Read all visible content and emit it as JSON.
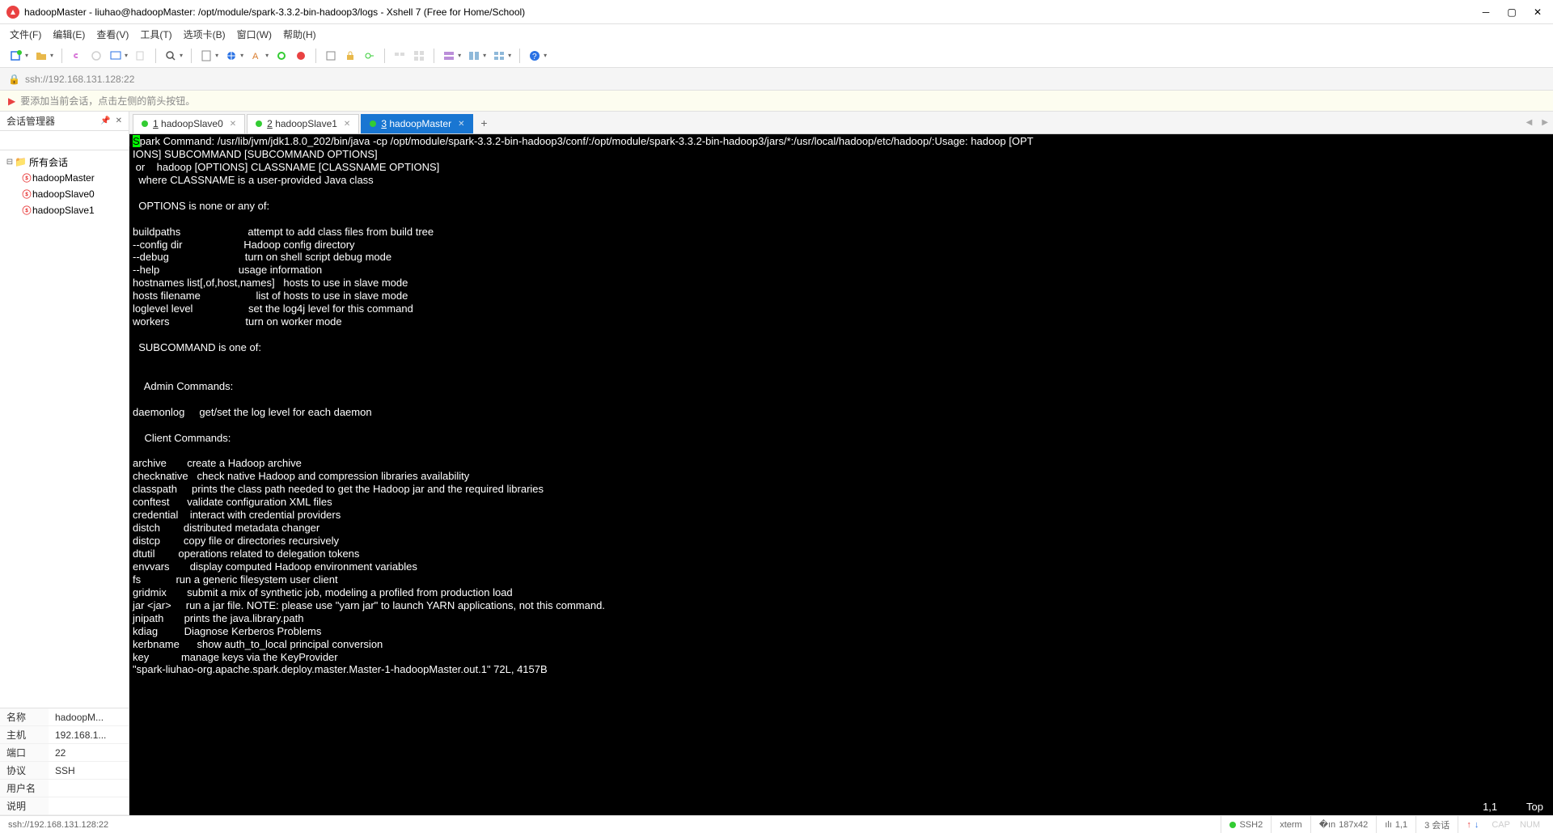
{
  "window": {
    "title": "hadoopMaster - liuhao@hadoopMaster: /opt/module/spark-3.3.2-bin-hadoop3/logs - Xshell 7 (Free for Home/School)"
  },
  "menu": {
    "items": [
      "文件(F)",
      "编辑(E)",
      "查看(V)",
      "工具(T)",
      "选项卡(B)",
      "窗口(W)",
      "帮助(H)"
    ]
  },
  "address": {
    "url": "ssh://192.168.131.128:22"
  },
  "tip": {
    "text": "要添加当前会话，点击左侧的箭头按钮。"
  },
  "sidebar": {
    "title": "会话管理器",
    "root": "所有会话",
    "items": [
      "hadoopMaster",
      "hadoopSlave0",
      "hadoopSlave1"
    ],
    "props": {
      "name_label": "名称",
      "name": "hadoopM...",
      "host_label": "主机",
      "host": "192.168.1...",
      "port_label": "端口",
      "port": "22",
      "proto_label": "协议",
      "proto": "SSH",
      "user_label": "用户名",
      "user": "",
      "desc_label": "说明",
      "desc": ""
    }
  },
  "tabs": {
    "items": [
      {
        "num": "1",
        "label": "hadoopSlave0",
        "color": "#3c3",
        "active": false
      },
      {
        "num": "2",
        "label": "hadoopSlave1",
        "color": "#3c3",
        "active": false
      },
      {
        "num": "3",
        "label": "hadoopMaster",
        "color": "#3c3",
        "active": true
      }
    ]
  },
  "terminal": {
    "line1a": "S",
    "line1b": "park Command: /usr/lib/jvm/jdk1.8.0_202/bin/java -cp /opt/module/spark-3.3.2-bin-hadoop3/conf/:/opt/module/spark-3.3.2-bin-hadoop3/jars/*:/usr/local/hadoop/etc/hadoop/:Usage: hadoop [OPT",
    "body": "IONS] SUBCOMMAND [SUBCOMMAND OPTIONS]\n or    hadoop [OPTIONS] CLASSNAME [CLASSNAME OPTIONS]\n  where CLASSNAME is a user-provided Java class\n\n  OPTIONS is none or any of:\n\nbuildpaths                       attempt to add class files from build tree\n--config dir                     Hadoop config directory\n--debug                          turn on shell script debug mode\n--help                           usage information\nhostnames list[,of,host,names]   hosts to use in slave mode\nhosts filename                   list of hosts to use in slave mode\nloglevel level                   set the log4j level for this command\nworkers                          turn on worker mode\n\n  SUBCOMMAND is one of:\n\n\n    Admin Commands:\n\ndaemonlog     get/set the log level for each daemon\n\n    Client Commands:\n\narchive       create a Hadoop archive\nchecknative   check native Hadoop and compression libraries availability\nclasspath     prints the class path needed to get the Hadoop jar and the required libraries\nconftest      validate configuration XML files\ncredential    interact with credential providers\ndistch        distributed metadata changer\ndistcp        copy file or directories recursively\ndtutil        operations related to delegation tokens\nenvvars       display computed Hadoop environment variables\nfs            run a generic filesystem user client\ngridmix       submit a mix of synthetic job, modeling a profiled from production load\njar <jar>     run a jar file. NOTE: please use \"yarn jar\" to launch YARN applications, not this command.\njnipath       prints the java.library.path\nkdiag         Diagnose Kerberos Problems\nkerbname      show auth_to_local principal conversion\nkey           manage keys via the KeyProvider\n\"spark-liuhao-org.apache.spark.deploy.master.Master-1-hadoopMaster.out.1\" 72L, 4157B",
    "pos": "1,1",
    "scroll": "Top"
  },
  "status": {
    "left": "ssh://192.168.131.128:22",
    "ssh": "SSH2",
    "term": "xterm",
    "size": "187x42",
    "cursor": "1,1",
    "sessions": "3 会话",
    "cap": "CAP",
    "num": "NUM"
  }
}
